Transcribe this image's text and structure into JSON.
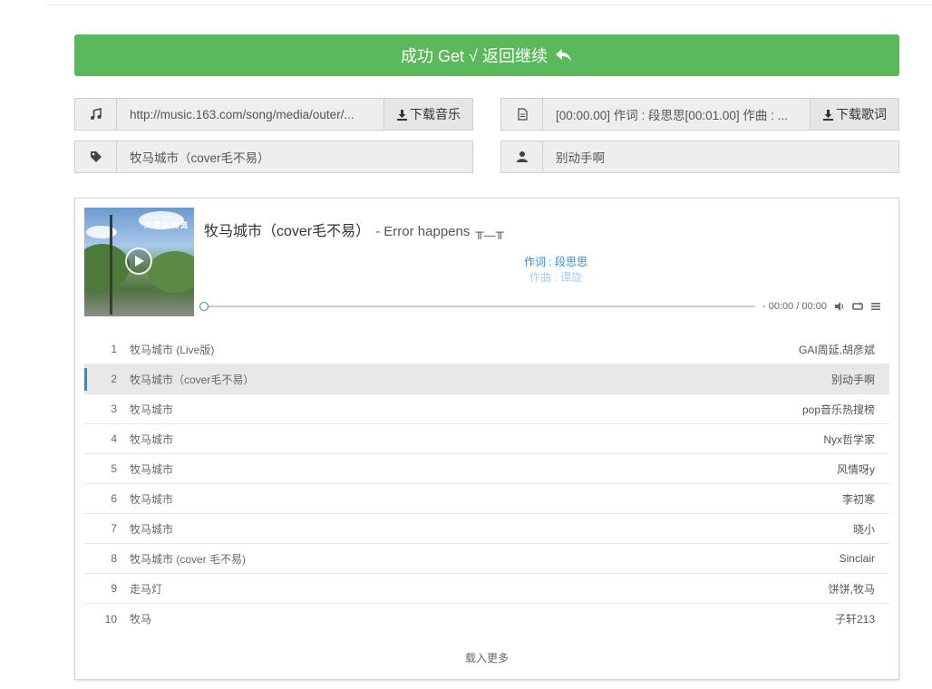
{
  "banner": {
    "label": "成功 Get √ 返回继续"
  },
  "music_field": {
    "icon": "music-note-icon",
    "value": "http://music.163.com/song/media/outer/...",
    "button": "下载音乐"
  },
  "lyric_field": {
    "icon": "file-text-icon",
    "value": "[00:00.00] 作词 : 段思思[00:01.00] 作曲 : ...",
    "button": "下载歌词"
  },
  "title_field": {
    "icon": "tag-icon",
    "value": "牧马城市（cover毛不易）"
  },
  "artist_field": {
    "icon": "user-icon",
    "value": "别动手啊"
  },
  "player": {
    "cover_text": "大猫向北流",
    "title": "牧马城市（cover毛不易）",
    "subtitle": "- Error happens",
    "emoji": "╥﹏╥",
    "lyric_current": "作词 : 段思思",
    "lyric_next": "作曲 : 谭旋",
    "progress": 0,
    "time": "- 00:00 / 00:00",
    "load_more": "载入更多"
  },
  "playlist": [
    {
      "num": "1",
      "name": "牧马城市 (Live版)",
      "artist": "GAI周延,胡彦斌"
    },
    {
      "num": "2",
      "name": "牧马城市（cover毛不易）",
      "artist": "别动手啊",
      "active": true
    },
    {
      "num": "3",
      "name": "牧马城市",
      "artist": "pop音乐热搜榜"
    },
    {
      "num": "4",
      "name": "牧马城市",
      "artist": "Nyx哲学家"
    },
    {
      "num": "5",
      "name": "牧马城市",
      "artist": "风情呀y"
    },
    {
      "num": "6",
      "name": "牧马城市",
      "artist": "李初寒"
    },
    {
      "num": "7",
      "name": "牧马城市",
      "artist": "晓小"
    },
    {
      "num": "8",
      "name": "牧马城市 (cover 毛不易)",
      "artist": "Sinclair"
    },
    {
      "num": "9",
      "name": "走马灯",
      "artist": "饼饼,牧马"
    },
    {
      "num": "10",
      "name": "牧马",
      "artist": "子轩213"
    }
  ],
  "colors": {
    "success": "#5cb85c",
    "accent": "#2d8bd3"
  }
}
